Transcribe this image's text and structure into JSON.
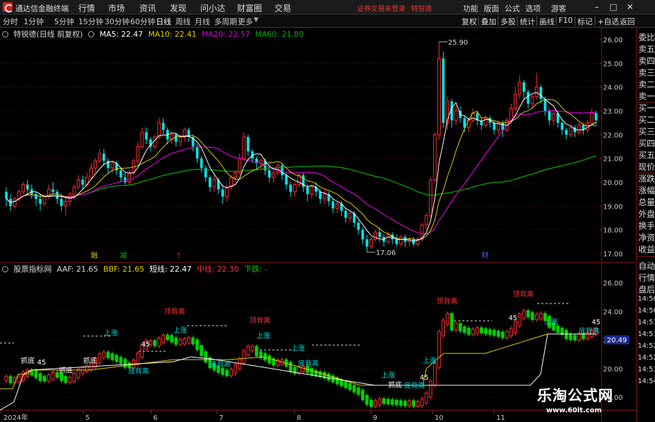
{
  "titlebar": {
    "app_title": "通达信金融终端",
    "menus": [
      "行情",
      "市场",
      "资讯",
      "发现",
      "问小达",
      "财富圈",
      "交易"
    ],
    "notice": "证券交易未登录",
    "stock": "特锐德",
    "right_menus": [
      "功能",
      "版面",
      "公式",
      "选项"
    ],
    "guest": "游客",
    "window_buttons": [
      "minimize-icon",
      "maximize-icon",
      "close-icon"
    ]
  },
  "toolbar": {
    "periods": [
      "分时",
      "1分钟",
      "5分钟",
      "15分钟",
      "30分钟",
      "60分钟",
      "日线",
      "周线",
      "月线",
      "多周期",
      "更多"
    ],
    "active_period": "日线",
    "tools": [
      "复权",
      "叠加",
      "多股",
      "统计",
      "画线",
      "F10",
      "标记",
      "+自选",
      "返回"
    ]
  },
  "main_panel": {
    "stock_label": "特锐德(日线 前复权)",
    "ma5": "MA5: 22.47",
    "ma10": "MA10: 22.41",
    "ma20": "MA20: 22.57",
    "ma60": "MA60: 21.80",
    "y_ticks": [
      "26.00",
      "25.00",
      "24.00",
      "23.00",
      "22.00",
      "21.00",
      "20.00",
      "19.00",
      "18.00",
      "17.00"
    ],
    "high_label": "25.90",
    "low_label": "17.06",
    "event_markers": [
      {
        "text": "融",
        "color": "#e8c800"
      },
      {
        "text": "减",
        "color": "#00c000"
      },
      {
        "text": "↑",
        "color": "#e02020"
      },
      {
        "text": "财",
        "color": "#4060ff"
      }
    ]
  },
  "sub_panel": {
    "indicator_name": "股票指标网",
    "aaf": "AAF: 21.65",
    "bbf": "BBF: 21.65",
    "short": "短线: 22.47",
    "mid": "中线: 22.30",
    "down": "下跌: -",
    "y_ticks": [
      "26.00",
      "24.00",
      "22.00",
      "20.00",
      "18.00"
    ],
    "current_value": "20.49",
    "annotations": [
      {
        "text": "顶背离",
        "color": "#ff3030"
      },
      {
        "text": "顶背离",
        "color": "#ff3030"
      },
      {
        "text": "顶背离",
        "color": "#ff3030"
      },
      {
        "text": "顶背离",
        "color": "#ff3030"
      },
      {
        "text": "底背离",
        "color": "#00d0d0"
      },
      {
        "text": "底背离",
        "color": "#00d0d0"
      },
      {
        "text": "底背离",
        "color": "#00d0d0"
      },
      {
        "text": "底背离",
        "color": "#00d0d0"
      },
      {
        "text": "底背离",
        "color": "#00d0d0"
      },
      {
        "text": "抓底",
        "color": "#ffffff"
      },
      {
        "text": "抓底",
        "color": "#ffffff"
      },
      {
        "text": "抓底",
        "color": "#ffffff"
      },
      {
        "text": "抓底",
        "color": "#ffffff"
      },
      {
        "text": "上涨",
        "color": "#00e0e0"
      },
      {
        "text": "上涨",
        "color": "#00e0e0"
      },
      {
        "text": "上涨",
        "color": "#00e0e0"
      },
      {
        "text": "上涨",
        "color": "#00e0e0"
      },
      {
        "text": "上涨",
        "color": "#00e0e0"
      },
      {
        "text": "上涨",
        "color": "#00e0e0"
      },
      {
        "text": "上涨",
        "color": "#00e0e0"
      },
      {
        "text": "45",
        "color": "#ffffff"
      },
      {
        "text": "45",
        "color": "#ffffff"
      },
      {
        "text": "45",
        "color": "#ffffff"
      },
      {
        "text": "45",
        "color": "#ffffff"
      },
      {
        "text": "45",
        "color": "#ffffff"
      }
    ]
  },
  "x_axis": [
    "2024年",
    "5",
    "6",
    "7",
    "8",
    "9",
    "10",
    "11"
  ],
  "side_panel": [
    "委比",
    "卖五",
    "卖四",
    "卖三",
    "卖二",
    "卖一",
    "买一",
    "买二",
    "买三",
    "买四",
    "买五",
    "现价",
    "涨跌",
    "涨幅",
    "总量",
    "外盘",
    "换手",
    "净资",
    "收益",
    "自动",
    "行情",
    "盘后",
    "14:50",
    "14:50",
    "14:51",
    "14:51",
    "14:52",
    "14:52",
    "14:53",
    "14:54"
  ],
  "watermark": {
    "cn": "乐淘公式网",
    "url": "www.60lt.com"
  },
  "colors": {
    "up": "#ff2d2d",
    "down": "#00e5e5",
    "ma5": "#ffffff",
    "ma10": "#e0d000",
    "ma20": "#d000d0",
    "ma60": "#00b000",
    "grid": "#8b1a1a"
  },
  "chart_data": {
    "type": "candlestick",
    "ylim": [
      16.8,
      26.6
    ],
    "candles": [
      {
        "o": 19.6,
        "c": 19.3,
        "h": 19.8,
        "l": 19.0
      },
      {
        "o": 19.3,
        "c": 19.0,
        "h": 19.5,
        "l": 18.8
      },
      {
        "o": 19.0,
        "c": 19.3,
        "h": 19.4,
        "l": 18.9
      },
      {
        "o": 19.3,
        "c": 19.6,
        "h": 19.7,
        "l": 19.2
      },
      {
        "o": 19.6,
        "c": 19.9,
        "h": 20.0,
        "l": 19.5
      },
      {
        "o": 19.9,
        "c": 19.7,
        "h": 20.1,
        "l": 19.5
      },
      {
        "o": 19.7,
        "c": 19.5,
        "h": 19.9,
        "l": 19.3
      },
      {
        "o": 19.5,
        "c": 19.3,
        "h": 19.6,
        "l": 19.0
      },
      {
        "o": 19.3,
        "c": 19.1,
        "h": 19.5,
        "l": 18.8
      },
      {
        "o": 19.1,
        "c": 19.4,
        "h": 19.5,
        "l": 19.0
      },
      {
        "o": 19.4,
        "c": 19.7,
        "h": 19.9,
        "l": 19.3
      },
      {
        "o": 19.7,
        "c": 19.6,
        "h": 20.0,
        "l": 19.4
      },
      {
        "o": 19.6,
        "c": 19.3,
        "h": 19.7,
        "l": 19.1
      },
      {
        "o": 19.3,
        "c": 19.0,
        "h": 19.5,
        "l": 18.8
      },
      {
        "o": 19.0,
        "c": 19.2,
        "h": 19.4,
        "l": 18.6
      },
      {
        "o": 19.2,
        "c": 19.5,
        "h": 19.6,
        "l": 19.0
      },
      {
        "o": 19.5,
        "c": 19.8,
        "h": 19.9,
        "l": 19.3
      },
      {
        "o": 19.8,
        "c": 20.1,
        "h": 20.3,
        "l": 19.7
      },
      {
        "o": 20.1,
        "c": 19.9,
        "h": 20.3,
        "l": 19.7
      },
      {
        "o": 19.9,
        "c": 20.2,
        "h": 20.4,
        "l": 19.8
      },
      {
        "o": 20.2,
        "c": 20.6,
        "h": 20.8,
        "l": 20.1
      },
      {
        "o": 20.6,
        "c": 20.9,
        "h": 21.0,
        "l": 20.4
      },
      {
        "o": 20.9,
        "c": 21.2,
        "h": 21.4,
        "l": 20.8
      },
      {
        "o": 21.2,
        "c": 20.9,
        "h": 21.4,
        "l": 20.7
      },
      {
        "o": 20.9,
        "c": 20.6,
        "h": 21.0,
        "l": 20.4
      },
      {
        "o": 20.6,
        "c": 20.8,
        "h": 20.9,
        "l": 20.4
      },
      {
        "o": 20.8,
        "c": 20.5,
        "h": 20.9,
        "l": 20.3
      },
      {
        "o": 20.5,
        "c": 20.2,
        "h": 20.6,
        "l": 20.0
      },
      {
        "o": 20.2,
        "c": 20.0,
        "h": 20.4,
        "l": 19.9
      },
      {
        "o": 20.0,
        "c": 20.4,
        "h": 20.5,
        "l": 19.9
      },
      {
        "o": 20.4,
        "c": 20.9,
        "h": 21.0,
        "l": 20.3
      },
      {
        "o": 20.9,
        "c": 21.5,
        "h": 21.7,
        "l": 20.8
      },
      {
        "o": 21.5,
        "c": 22.1,
        "h": 22.3,
        "l": 21.4
      },
      {
        "o": 22.1,
        "c": 21.8,
        "h": 22.3,
        "l": 21.6
      },
      {
        "o": 21.8,
        "c": 21.5,
        "h": 21.9,
        "l": 21.3
      },
      {
        "o": 21.5,
        "c": 21.9,
        "h": 22.0,
        "l": 21.4
      },
      {
        "o": 21.9,
        "c": 22.5,
        "h": 22.7,
        "l": 21.8
      },
      {
        "o": 22.5,
        "c": 22.2,
        "h": 22.7,
        "l": 22.0
      },
      {
        "o": 22.2,
        "c": 21.8,
        "h": 22.3,
        "l": 21.6
      },
      {
        "o": 21.8,
        "c": 22.0,
        "h": 22.1,
        "l": 21.6
      },
      {
        "o": 22.0,
        "c": 21.7,
        "h": 22.1,
        "l": 21.5
      },
      {
        "o": 21.7,
        "c": 21.9,
        "h": 22.0,
        "l": 21.5
      },
      {
        "o": 21.9,
        "c": 22.2,
        "h": 22.3,
        "l": 21.7
      },
      {
        "o": 22.2,
        "c": 21.9,
        "h": 22.3,
        "l": 21.7
      },
      {
        "o": 21.9,
        "c": 21.5,
        "h": 22.0,
        "l": 21.3
      },
      {
        "o": 21.5,
        "c": 21.0,
        "h": 21.6,
        "l": 20.8
      },
      {
        "o": 21.0,
        "c": 20.6,
        "h": 21.1,
        "l": 20.4
      },
      {
        "o": 20.6,
        "c": 20.2,
        "h": 20.7,
        "l": 20.0
      },
      {
        "o": 20.2,
        "c": 19.8,
        "h": 20.3,
        "l": 19.6
      },
      {
        "o": 19.8,
        "c": 20.1,
        "h": 20.3,
        "l": 19.6
      },
      {
        "o": 20.1,
        "c": 19.7,
        "h": 20.2,
        "l": 19.5
      },
      {
        "o": 19.7,
        "c": 19.4,
        "h": 19.9,
        "l": 19.1
      },
      {
        "o": 19.4,
        "c": 19.8,
        "h": 19.9,
        "l": 19.2
      },
      {
        "o": 19.8,
        "c": 20.2,
        "h": 20.3,
        "l": 19.7
      },
      {
        "o": 20.2,
        "c": 20.4,
        "h": 20.5,
        "l": 20.0
      },
      {
        "o": 20.4,
        "c": 21.0,
        "h": 21.2,
        "l": 20.3
      },
      {
        "o": 21.0,
        "c": 21.9,
        "h": 22.1,
        "l": 20.9
      },
      {
        "o": 21.9,
        "c": 21.3,
        "h": 22.0,
        "l": 21.1
      },
      {
        "o": 21.3,
        "c": 21.0,
        "h": 21.4,
        "l": 20.8
      },
      {
        "o": 21.0,
        "c": 20.8,
        "h": 21.1,
        "l": 20.5
      },
      {
        "o": 20.8,
        "c": 20.9,
        "h": 21.0,
        "l": 20.5
      },
      {
        "o": 20.9,
        "c": 20.5,
        "h": 21.0,
        "l": 20.3
      },
      {
        "o": 20.5,
        "c": 20.2,
        "h": 20.7,
        "l": 20.0
      },
      {
        "o": 20.2,
        "c": 20.4,
        "h": 20.5,
        "l": 20.0
      },
      {
        "o": 20.4,
        "c": 20.7,
        "h": 20.8,
        "l": 20.3
      },
      {
        "o": 20.7,
        "c": 20.3,
        "h": 20.8,
        "l": 20.1
      },
      {
        "o": 20.3,
        "c": 19.9,
        "h": 20.4,
        "l": 19.7
      },
      {
        "o": 19.9,
        "c": 19.6,
        "h": 20.0,
        "l": 19.4
      },
      {
        "o": 19.6,
        "c": 19.9,
        "h": 20.0,
        "l": 19.4
      },
      {
        "o": 19.9,
        "c": 20.3,
        "h": 20.4,
        "l": 19.8
      },
      {
        "o": 20.3,
        "c": 19.8,
        "h": 20.4,
        "l": 19.6
      },
      {
        "o": 19.8,
        "c": 19.5,
        "h": 19.9,
        "l": 19.2
      },
      {
        "o": 19.5,
        "c": 19.8,
        "h": 19.9,
        "l": 19.3
      },
      {
        "o": 19.8,
        "c": 19.6,
        "h": 20.0,
        "l": 19.4
      },
      {
        "o": 19.6,
        "c": 19.3,
        "h": 19.7,
        "l": 19.1
      },
      {
        "o": 19.3,
        "c": 19.5,
        "h": 19.7,
        "l": 19.1
      },
      {
        "o": 19.5,
        "c": 19.2,
        "h": 19.6,
        "l": 19.0
      },
      {
        "o": 19.2,
        "c": 18.9,
        "h": 19.3,
        "l": 18.7
      },
      {
        "o": 18.9,
        "c": 19.1,
        "h": 19.2,
        "l": 18.7
      },
      {
        "o": 19.1,
        "c": 18.8,
        "h": 19.2,
        "l": 18.6
      },
      {
        "o": 18.8,
        "c": 18.5,
        "h": 18.9,
        "l": 18.3
      },
      {
        "o": 18.5,
        "c": 18.7,
        "h": 18.8,
        "l": 18.3
      },
      {
        "o": 18.7,
        "c": 18.3,
        "h": 18.8,
        "l": 18.1
      },
      {
        "o": 18.3,
        "c": 18.0,
        "h": 18.4,
        "l": 17.8
      },
      {
        "o": 18.0,
        "c": 17.6,
        "h": 18.1,
        "l": 17.4
      },
      {
        "o": 17.6,
        "c": 17.3,
        "h": 17.8,
        "l": 17.06
      },
      {
        "o": 17.3,
        "c": 17.6,
        "h": 17.7,
        "l": 17.2
      },
      {
        "o": 17.6,
        "c": 17.9,
        "h": 18.0,
        "l": 17.5
      },
      {
        "o": 17.9,
        "c": 17.7,
        "h": 18.1,
        "l": 17.5
      },
      {
        "o": 17.7,
        "c": 17.5,
        "h": 17.8,
        "l": 17.3
      },
      {
        "o": 17.5,
        "c": 17.8,
        "h": 17.9,
        "l": 17.4
      },
      {
        "o": 17.8,
        "c": 17.6,
        "h": 17.9,
        "l": 17.4
      },
      {
        "o": 17.6,
        "c": 17.4,
        "h": 17.8,
        "l": 17.3
      },
      {
        "o": 17.4,
        "c": 17.7,
        "h": 17.8,
        "l": 17.3
      },
      {
        "o": 17.7,
        "c": 17.5,
        "h": 17.8,
        "l": 17.3
      },
      {
        "o": 17.5,
        "c": 17.6,
        "h": 17.7,
        "l": 17.3
      },
      {
        "o": 17.6,
        "c": 17.4,
        "h": 17.7,
        "l": 17.3
      },
      {
        "o": 17.4,
        "c": 17.6,
        "h": 17.7,
        "l": 17.3
      },
      {
        "o": 17.6,
        "c": 18.2,
        "h": 18.3,
        "l": 17.5
      },
      {
        "o": 18.2,
        "c": 18.6,
        "h": 18.7,
        "l": 18.0
      },
      {
        "o": 18.6,
        "c": 20.1,
        "h": 20.2,
        "l": 18.5
      },
      {
        "o": 20.1,
        "c": 22.0,
        "h": 22.1,
        "l": 20.0
      },
      {
        "o": 22.0,
        "c": 25.2,
        "h": 25.9,
        "l": 21.8
      },
      {
        "o": 25.2,
        "c": 22.5,
        "h": 25.5,
        "l": 22.3
      },
      {
        "o": 22.5,
        "c": 23.4,
        "h": 23.6,
        "l": 22.2
      },
      {
        "o": 23.4,
        "c": 22.6,
        "h": 23.5,
        "l": 22.3
      },
      {
        "o": 22.6,
        "c": 23.0,
        "h": 23.2,
        "l": 22.4
      },
      {
        "o": 23.0,
        "c": 22.7,
        "h": 23.2,
        "l": 22.5
      },
      {
        "o": 22.7,
        "c": 22.3,
        "h": 22.8,
        "l": 22.1
      },
      {
        "o": 22.3,
        "c": 22.6,
        "h": 22.7,
        "l": 22.1
      },
      {
        "o": 22.6,
        "c": 22.9,
        "h": 23.1,
        "l": 22.5
      },
      {
        "o": 22.9,
        "c": 22.6,
        "h": 23.0,
        "l": 22.4
      },
      {
        "o": 22.6,
        "c": 22.4,
        "h": 22.7,
        "l": 22.2
      },
      {
        "o": 22.4,
        "c": 22.7,
        "h": 22.8,
        "l": 22.3
      },
      {
        "o": 22.7,
        "c": 22.5,
        "h": 22.8,
        "l": 22.3
      },
      {
        "o": 22.5,
        "c": 22.2,
        "h": 22.6,
        "l": 22.0
      },
      {
        "o": 22.2,
        "c": 22.5,
        "h": 22.6,
        "l": 22.0
      },
      {
        "o": 22.5,
        "c": 22.2,
        "h": 22.6,
        "l": 21.9
      },
      {
        "o": 22.2,
        "c": 22.6,
        "h": 22.7,
        "l": 22.1
      },
      {
        "o": 22.6,
        "c": 23.1,
        "h": 23.3,
        "l": 22.5
      },
      {
        "o": 23.1,
        "c": 23.7,
        "h": 24.0,
        "l": 23.0
      },
      {
        "o": 23.7,
        "c": 24.2,
        "h": 24.5,
        "l": 23.5
      },
      {
        "o": 24.2,
        "c": 23.8,
        "h": 24.3,
        "l": 23.5
      },
      {
        "o": 23.8,
        "c": 23.3,
        "h": 23.9,
        "l": 23.1
      },
      {
        "o": 23.3,
        "c": 23.6,
        "h": 23.7,
        "l": 23.1
      },
      {
        "o": 23.6,
        "c": 24.0,
        "h": 24.6,
        "l": 23.5
      },
      {
        "o": 24.0,
        "c": 23.5,
        "h": 24.1,
        "l": 23.3
      },
      {
        "o": 23.5,
        "c": 23.0,
        "h": 23.6,
        "l": 22.8
      },
      {
        "o": 23.0,
        "c": 22.6,
        "h": 23.1,
        "l": 22.4
      },
      {
        "o": 22.6,
        "c": 22.9,
        "h": 23.0,
        "l": 22.4
      },
      {
        "o": 22.9,
        "c": 22.5,
        "h": 23.0,
        "l": 22.3
      },
      {
        "o": 22.5,
        "c": 22.2,
        "h": 22.6,
        "l": 22.0
      },
      {
        "o": 22.2,
        "c": 22.0,
        "h": 22.3,
        "l": 21.8
      },
      {
        "o": 22.0,
        "c": 22.3,
        "h": 22.4,
        "l": 21.9
      },
      {
        "o": 22.3,
        "c": 22.1,
        "h": 22.4,
        "l": 21.9
      },
      {
        "o": 22.1,
        "c": 22.4,
        "h": 22.5,
        "l": 22.0
      },
      {
        "o": 22.4,
        "c": 22.2,
        "h": 22.5,
        "l": 22.0
      },
      {
        "o": 22.2,
        "c": 22.5,
        "h": 22.6,
        "l": 22.1
      },
      {
        "o": 22.5,
        "c": 22.9,
        "h": 23.1,
        "l": 22.4
      },
      {
        "o": 22.9,
        "c": 22.6,
        "h": 23.0,
        "l": 22.4
      }
    ]
  }
}
